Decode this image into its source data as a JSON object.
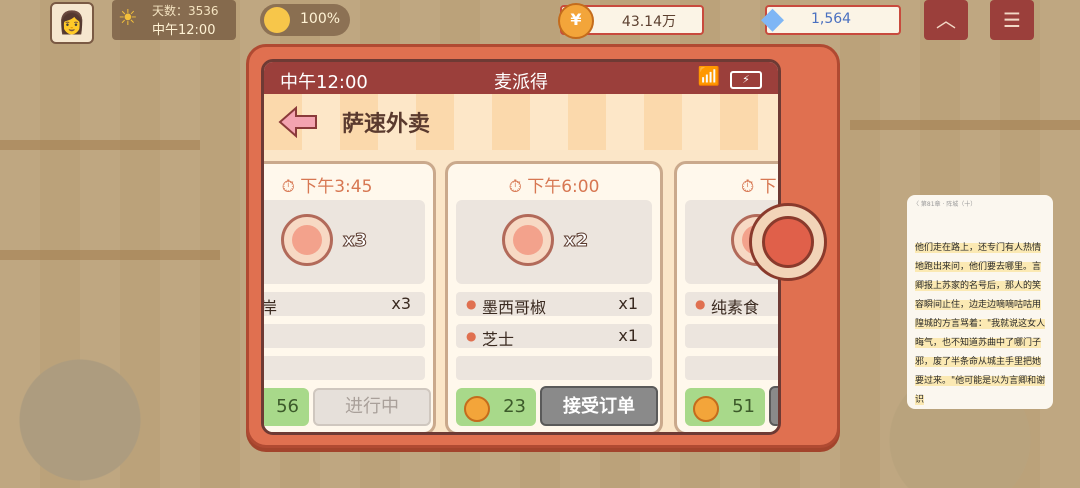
{
  "hud": {
    "day_label": "天数：3536",
    "time": "中午12:00",
    "mood": "100%",
    "coins": "43.14万",
    "gems": "1,564"
  },
  "phone": {
    "status_time": "中午12:00",
    "app_name": "麦派得",
    "page_title": "萨速外卖",
    "orders": [
      {
        "time": "下午3:45",
        "pizza_qty": "x3",
        "items": [
          {
            "name": "典海岸",
            "qty": "x3"
          }
        ],
        "reward": "56",
        "action": "进行中"
      },
      {
        "time": "下午6:00",
        "pizza_qty": "x2",
        "items": [
          {
            "name": "墨西哥椒",
            "qty": "x1"
          },
          {
            "name": "芝士",
            "qty": "x1"
          }
        ],
        "reward": "23",
        "action": "接受订单"
      },
      {
        "time": "下",
        "pizza_qty": "",
        "items": [
          {
            "name": "纯素食",
            "qty": ""
          }
        ],
        "reward": "51",
        "action": ""
      }
    ]
  },
  "book": {
    "header": "〈 第81章 · 阵城（十）",
    "text": "他们走在路上，还专门有人热情地跑出来问，他们要去哪里。言卿报上苏家的名号后，那人的笑容瞬间止住，边走边嘀嘀咕咕用隍城的方言骂着：\"我就说这女人晦气，也不知道苏曲中了哪门子邪，废了半条命从城主手里把她要过来。\"他可能是以为言卿和谢识"
  },
  "colors": {
    "phone_body": "#e07050",
    "status_bar": "#9b3f3b",
    "accent_time": "#d77752",
    "reward_bg": "#a8d98a"
  }
}
